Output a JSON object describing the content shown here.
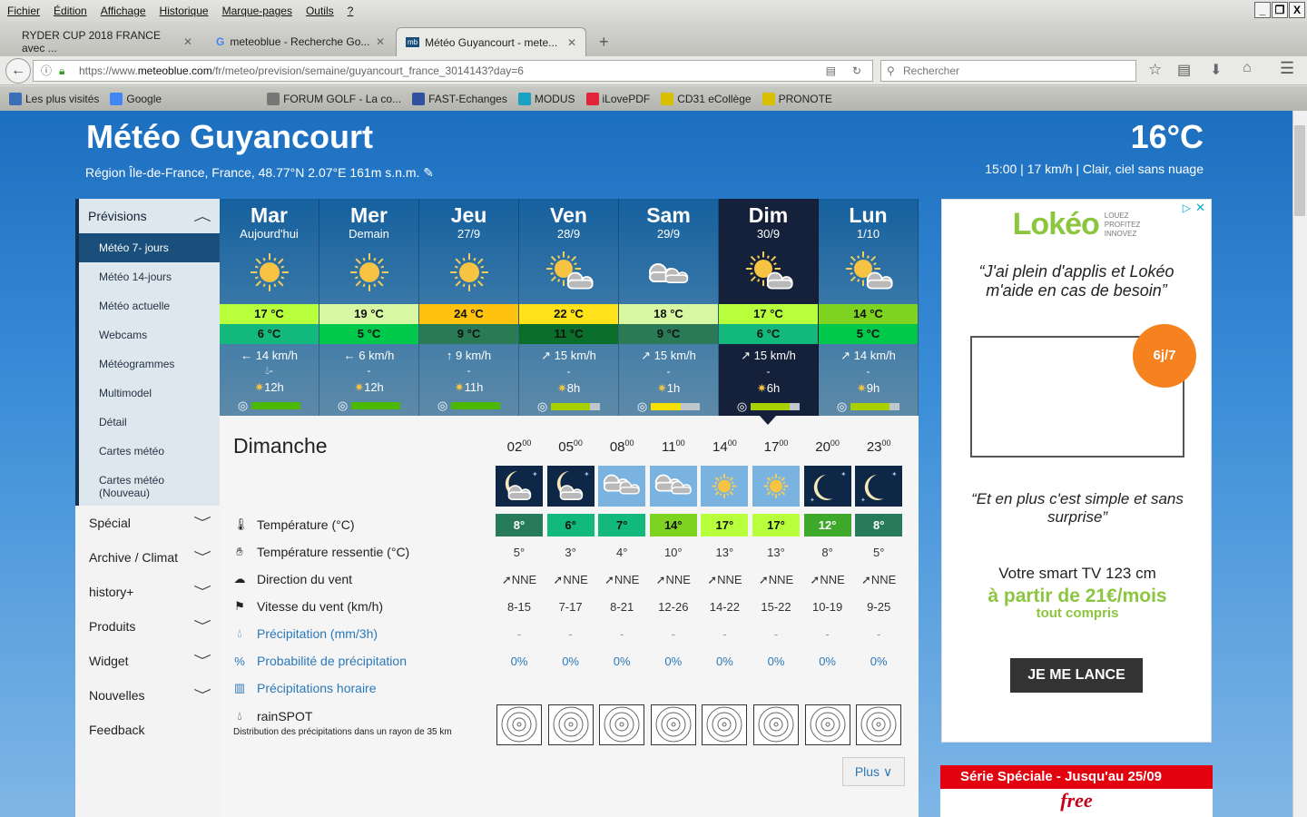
{
  "browser": {
    "menu": [
      "Fichier",
      "Édition",
      "Affichage",
      "Historique",
      "Marque-pages",
      "Outils",
      "?"
    ],
    "tabs": [
      {
        "title": "RYDER CUP 2018 FRANCE avec ...",
        "active": false
      },
      {
        "title": "meteoblue - Recherche Go...",
        "active": false
      },
      {
        "title": "Météo Guyancourt - mete...",
        "active": true
      }
    ],
    "url_prefix": "https://www.",
    "url_host": "meteoblue.com",
    "url_path": "/fr/meteo/prevision/semaine/guyancourt_france_3014143?day=6",
    "search_placeholder": "Rechercher",
    "bookmarks": [
      "Les plus visités",
      "Google",
      "FORUM GOLF - La co...",
      "FAST-Echanges",
      "MODUS",
      "iLovePDF",
      "CD31 eCollège",
      "PRONOTE"
    ]
  },
  "header": {
    "title": "Météo Guyancourt",
    "subtitle": "Région Île-de-France, France, 48.77°N 2.07°E 161m s.n.m.",
    "current_temp": "16°C",
    "current_info": "15:00 | 17 km/h | Clair, ciel sans nuage"
  },
  "sidebar": {
    "section": "Prévisions",
    "subitems": [
      "Météo 7- jours",
      "Météo 14-jours",
      "Météo actuelle",
      "Webcams",
      "Météogrammes",
      "Multimodel",
      "Détail",
      "Cartes météo",
      "Cartes météo (Nouveau)"
    ],
    "active_sub": 0,
    "items": [
      {
        "label": "Spécial",
        "chevron": true
      },
      {
        "label": "Archive / Climat",
        "chevron": true
      },
      {
        "label": "history+",
        "chevron": true
      },
      {
        "label": "Produits",
        "chevron": true
      },
      {
        "label": "Widget",
        "chevron": true
      },
      {
        "label": "Nouvelles",
        "chevron": true
      },
      {
        "label": "Feedback",
        "chevron": false
      }
    ]
  },
  "days": [
    {
      "name": "Mar",
      "date": "Aujourd'hui",
      "icon": "sun",
      "max": "17 °C",
      "maxc": "#b8ff3c",
      "min": "6 °C",
      "minc": "#12b87c",
      "wind": "14 km/h",
      "windarrow": "←",
      "prec": "-",
      "precdrop": true,
      "sun": "12h",
      "pred": 1.0,
      "predc": "#4cb800"
    },
    {
      "name": "Mer",
      "date": "Demain",
      "icon": "sun",
      "max": "19 °C",
      "maxc": "#d8f7a2",
      "min": "5 °C",
      "minc": "#00c84a",
      "wind": "6 km/h",
      "windarrow": "←",
      "prec": "-",
      "sun": "12h",
      "pred": 1.0,
      "predc": "#4cb800"
    },
    {
      "name": "Jeu",
      "date": "27/9",
      "icon": "sun",
      "max": "24 °C",
      "maxc": "#ffc30f",
      "min": "9 °C",
      "minc": "#2a7a56",
      "wind": "9 km/h",
      "windarrow": "↑",
      "prec": "-",
      "sun": "11h",
      "pred": 1.0,
      "predc": "#4cb800"
    },
    {
      "name": "Ven",
      "date": "28/9",
      "icon": "sun-cloud",
      "max": "22 °C",
      "maxc": "#ffe21a",
      "min": "11 °C",
      "minc": "#0a6d2a",
      "wind": "15 km/h",
      "windarrow": "↗",
      "prec": "-",
      "sun": "8h",
      "pred": 0.8,
      "predc": "#a8d000"
    },
    {
      "name": "Sam",
      "date": "29/9",
      "icon": "cloud",
      "max": "18 °C",
      "maxc": "#d8f7a2",
      "min": "9 °C",
      "minc": "#2a7a56",
      "wind": "15 km/h",
      "windarrow": "↗",
      "prec": "-",
      "sun": "1h",
      "pred": 0.6,
      "predc": "#f5e000"
    },
    {
      "name": "Dim",
      "date": "30/9",
      "icon": "sun-cloud",
      "max": "17 °C",
      "maxc": "#b8ff3c",
      "min": "6 °C",
      "minc": "#12b87c",
      "wind": "15 km/h",
      "windarrow": "↗",
      "prec": "-",
      "sun": "6h",
      "pred": 0.8,
      "predc": "#a8d000",
      "selected": true
    },
    {
      "name": "Lun",
      "date": "1/10",
      "icon": "sun-cloud",
      "max": "14 °C",
      "maxc": "#7ed321",
      "min": "5 °C",
      "minc": "#00c84a",
      "wind": "14 km/h",
      "windarrow": "↗",
      "prec": "-",
      "sun": "9h",
      "pred": 0.8,
      "predc": "#a8d000"
    }
  ],
  "detail": {
    "title": "Dimanche",
    "hours": [
      {
        "h": "02",
        "icon": "moon-cloud",
        "t": "8°",
        "tc": "#277a5a",
        "tw": true,
        "feel": "5°",
        "dir": "NNE",
        "speed": "8-15",
        "prec": "-",
        "prob": "0%"
      },
      {
        "h": "05",
        "icon": "moon-cloud",
        "t": "6°",
        "tc": "#12b87c",
        "feel": "3°",
        "dir": "NNE",
        "speed": "7-17",
        "prec": "-",
        "prob": "0%"
      },
      {
        "h": "08",
        "icon": "cloud-day",
        "t": "7°",
        "tc": "#12b87c",
        "feel": "4°",
        "dir": "NNE",
        "speed": "8-21",
        "prec": "-",
        "prob": "0%"
      },
      {
        "h": "11",
        "icon": "cloud-day",
        "t": "14°",
        "tc": "#7ed321",
        "feel": "10°",
        "dir": "NNE",
        "speed": "12-26",
        "prec": "-",
        "prob": "0%"
      },
      {
        "h": "14",
        "icon": "sun-day",
        "t": "17°",
        "tc": "#b8ff3c",
        "feel": "13°",
        "dir": "NNE",
        "speed": "14-22",
        "prec": "-",
        "prob": "0%"
      },
      {
        "h": "17",
        "icon": "sun-day",
        "t": "17°",
        "tc": "#b8ff3c",
        "feel": "13°",
        "dir": "NNE",
        "speed": "15-22",
        "prec": "-",
        "prob": "0%"
      },
      {
        "h": "20",
        "icon": "moon",
        "t": "12°",
        "tc": "#3ea82a",
        "tw": true,
        "feel": "8°",
        "dir": "NNE",
        "speed": "10-19",
        "prec": "-",
        "prob": "0%"
      },
      {
        "h": "23",
        "icon": "moon",
        "t": "8°",
        "tc": "#277a5a",
        "tw": true,
        "feel": "5°",
        "dir": "NNE",
        "speed": "9-25",
        "prec": "-",
        "prob": "0%"
      }
    ],
    "rows": {
      "temp": "Température (°C)",
      "feel": "Température ressentie (°C)",
      "dir": "Direction du vent",
      "speed": "Vitesse du vent (km/h)",
      "prec": "Précipitation (mm/3h)",
      "prob": "Probabilité de précipitation",
      "hourly": "Précipitations horaire",
      "rainspot": "rainSPOT",
      "rainspot_desc": "Distribution des précipitations dans un rayon de 35 km"
    },
    "plus": "Plus"
  },
  "ads": {
    "brand": "Lokéo",
    "tagline": [
      "LOUEZ",
      "PROFITEZ",
      "INNOVEZ"
    ],
    "quote1": "“J'ai plein d'applis et Lokéo m'aide en cas de besoin”",
    "badge": "6j/7",
    "quote2": "“Et en plus c'est simple et sans surprise”",
    "offer": "Votre smart TV 123 cm",
    "price": "à partir de 21€/mois",
    "price_sub": "tout compris",
    "cta": "JE ME LANCE",
    "ad2_title": "Série Spéciale - Jusqu'au 25/09",
    "ad2_brand": "free"
  },
  "colors": {
    "accent": "#2a78b8",
    "selected_day": "#15213a",
    "ad_green": "#8cc63f"
  }
}
